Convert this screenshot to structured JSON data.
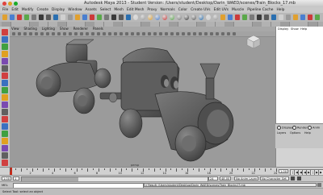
{
  "window": {
    "title": "Autodesk Maya 2013 - Student Version: /Users/student/Desktop/Darin_WAED/scenes/Train_Blocks_17.mb"
  },
  "menubar": {
    "items": [
      "File",
      "Edit",
      "Modify",
      "Create",
      "Display",
      "Window",
      "Assets",
      "Select",
      "Mesh",
      "Edit Mesh",
      "Proxy",
      "Normals",
      "Color",
      "Create UVs",
      "Edit UVs",
      "Muscle",
      "Pipeline Cache",
      "Help"
    ]
  },
  "viewport": {
    "menu": [
      "View",
      "Shading",
      "Lighting",
      "Show",
      "Renderer",
      "Panels"
    ],
    "camera_label": "persp"
  },
  "right_panel": {
    "menu": [
      "Display",
      "Show",
      "Help"
    ]
  },
  "layer_editor": {
    "options": [
      "Display",
      "Render",
      "Anim"
    ],
    "menu": [
      "Layers",
      "Options",
      "Help"
    ]
  },
  "time_slider": {
    "ticks": [
      "2",
      "4",
      "6",
      "8",
      "10",
      "12",
      "14",
      "16",
      "18",
      "20",
      "22",
      "24"
    ],
    "start_field": "1.00",
    "start_frame": "1",
    "end_frame": "24",
    "end_field": "24.00",
    "range_end": "48.00",
    "current_frame": "1.00",
    "anim_layer": "No Anim Layer",
    "character_set": "No Character Set"
  },
  "command_line": {
    "mode": "MEL",
    "result": "// Result: /Users/student/Desktop/Darin_WAED/scenes/Train_Blocks17.mb"
  },
  "help_line": {
    "text": "Select Tool: select an object"
  },
  "colors": {
    "viewport_bg": "#9b9b9b",
    "model": "#5e5e5e",
    "timeline_marker": "#c62a1a"
  }
}
